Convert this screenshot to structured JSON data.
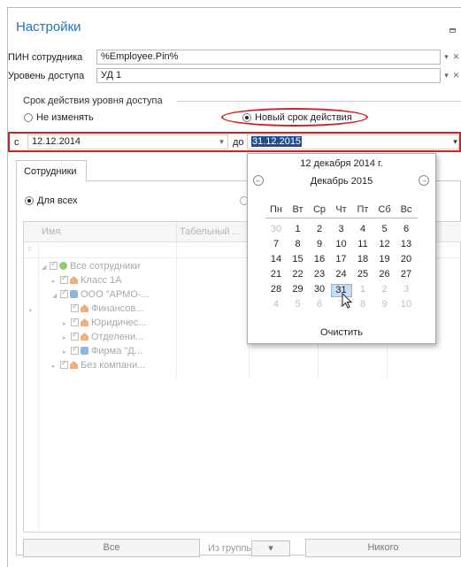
{
  "window": {
    "title": "Настройки"
  },
  "pin": {
    "label": "ПИН сотрудника",
    "value": "%Employee.Pin%"
  },
  "access_level": {
    "label": "Уровень доступа",
    "value": "УД 1"
  },
  "validity": {
    "group_title": "Срок действия уровня доступа",
    "option_no_change": "Не изменять",
    "option_new_period": "Новый срок действия",
    "from_label": "с",
    "from_value": "12.12.2014",
    "to_label": "до",
    "to_value": "31.12.2015"
  },
  "tabs": {
    "employees": "Сотрудники"
  },
  "scope": {
    "for_all": "Для всех"
  },
  "grid": {
    "columns": [
      "Имя",
      "Табельный ..."
    ],
    "filter_icon": "filter-icon",
    "rows": [
      {
        "indent": 0,
        "icon": "globe",
        "label": "Все сотрудники",
        "expander": "◢"
      },
      {
        "indent": 1,
        "icon": "house",
        "label": "Класс 1А",
        "expander": "▸"
      },
      {
        "indent": 1,
        "icon": "org",
        "label": "ООО \"АРМО-...",
        "expander": "◢"
      },
      {
        "indent": 2,
        "icon": "house",
        "label": "Финансов...",
        "expander": ""
      },
      {
        "indent": 2,
        "icon": "house",
        "label": "Юридичес...",
        "expander": "▸"
      },
      {
        "indent": 2,
        "icon": "house",
        "label": "Отделени...",
        "expander": "▸"
      },
      {
        "indent": 2,
        "icon": "org",
        "label": "Фирма \"Д...",
        "expander": "▸"
      },
      {
        "indent": 1,
        "icon": "house",
        "label": "Без компани...",
        "expander": "▸"
      }
    ]
  },
  "footer": {
    "all_button": "Все",
    "group_label": "Из группы",
    "none_button": "Никого"
  },
  "calendar": {
    "today_label": "12 декабря 2014 г.",
    "month_label": "Декабрь 2015",
    "weekdays": [
      "Пн",
      "Вт",
      "Ср",
      "Чт",
      "Пт",
      "Сб",
      "Вс"
    ],
    "weeks": [
      [
        {
          "d": "30",
          "o": true
        },
        {
          "d": "1"
        },
        {
          "d": "2"
        },
        {
          "d": "3"
        },
        {
          "d": "4"
        },
        {
          "d": "5"
        },
        {
          "d": "6"
        }
      ],
      [
        {
          "d": "7"
        },
        {
          "d": "8"
        },
        {
          "d": "9"
        },
        {
          "d": "10"
        },
        {
          "d": "11"
        },
        {
          "d": "12"
        },
        {
          "d": "13"
        }
      ],
      [
        {
          "d": "14"
        },
        {
          "d": "15"
        },
        {
          "d": "16"
        },
        {
          "d": "17"
        },
        {
          "d": "18"
        },
        {
          "d": "19"
        },
        {
          "d": "20"
        }
      ],
      [
        {
          "d": "21"
        },
        {
          "d": "22"
        },
        {
          "d": "23"
        },
        {
          "d": "24"
        },
        {
          "d": "25"
        },
        {
          "d": "26"
        },
        {
          "d": "27"
        }
      ],
      [
        {
          "d": "28"
        },
        {
          "d": "29"
        },
        {
          "d": "30"
        },
        {
          "d": "31",
          "sel": true
        },
        {
          "d": "1",
          "o": true
        },
        {
          "d": "2",
          "o": true
        },
        {
          "d": "3",
          "o": true
        }
      ],
      [
        {
          "d": "4",
          "o": true
        },
        {
          "d": "5",
          "o": true
        },
        {
          "d": "6",
          "o": true
        },
        {
          "d": "7",
          "o": true
        },
        {
          "d": "8",
          "o": true
        },
        {
          "d": "9",
          "o": true
        },
        {
          "d": "10",
          "o": true
        }
      ]
    ],
    "clear_label": "Очистить"
  },
  "colors": {
    "title": "#2a71b8",
    "highlight_red": "#d12121",
    "selected_text_bg": "#1f4e8c"
  }
}
